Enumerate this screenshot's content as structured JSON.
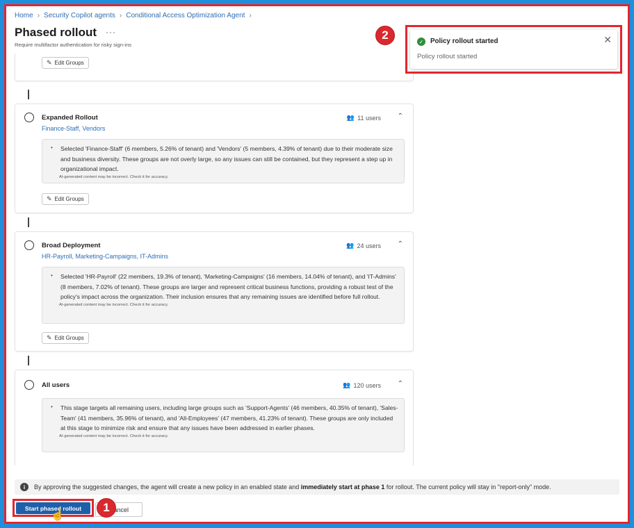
{
  "breadcrumb": [
    "Home",
    "Security Copilot agents",
    "Conditional Access Optimization Agent"
  ],
  "page": {
    "title": "Phased rollout",
    "more": "···",
    "subtitle": "Require multifactor authentication for risky sign-ins"
  },
  "edit_groups_label": "Edit Groups",
  "disclaimer": "AI-generated content may be incorrect. Check it for accuracy.",
  "stages": [
    {
      "title": "Expanded Rollout",
      "groups": "Finance-Staff,  Vendors",
      "users": "11 users",
      "reason": "Selected 'Finance-Staff' (6 members, 5.26% of tenant) and 'Vendors' (5 members, 4.39% of tenant) due to their moderate size and business diversity. These groups are not overly large, so any issues can still be contained, but they represent a step up in organizational impact."
    },
    {
      "title": "Broad Deployment",
      "groups": "HR-Payroll,  Marketing-Campaigns,  IT-Admins",
      "users": "24 users",
      "reason": "Selected 'HR-Payroll' (22 members, 19.3% of tenant), 'Marketing-Campaigns' (16 members, 14.04% of tenant), and 'IT-Admins' (8 members, 7.02% of tenant). These groups are larger and represent critical business functions, providing a robust test of the policy's impact across the organization. Their inclusion ensures that any remaining issues are identified before full rollout."
    },
    {
      "title": "All users",
      "users": "120 users",
      "reason": "This stage targets all remaining users, including large groups such as 'Support-Agents' (46 members, 40.35% of tenant), 'Sales-Team' (41 members, 35.96% of tenant), and 'All-Employees' (47 members, 41.23% of tenant). These groups are only included at this stage to minimize risk and ensure that any issues have been addressed in earlier phases."
    }
  ],
  "notice": {
    "before": "By approving the suggested changes, the agent will create a new policy in an enabled state and",
    "bold": "immediately start at phase 1",
    "after": "for rollout. The current policy will stay in \"report-only\" mode."
  },
  "buttons": {
    "start": "Start phased rollout",
    "cancel": "Cancel"
  },
  "toast": {
    "title": "Policy rollout started",
    "message": "Policy rollout started",
    "close": "✕"
  },
  "callouts": [
    "1",
    "2"
  ],
  "colors": {
    "accent": "#1d5fa9",
    "link": "#2e6db3",
    "highlight": "#e3262c",
    "success": "#2f8f3a",
    "background": "#1f8fdc"
  }
}
